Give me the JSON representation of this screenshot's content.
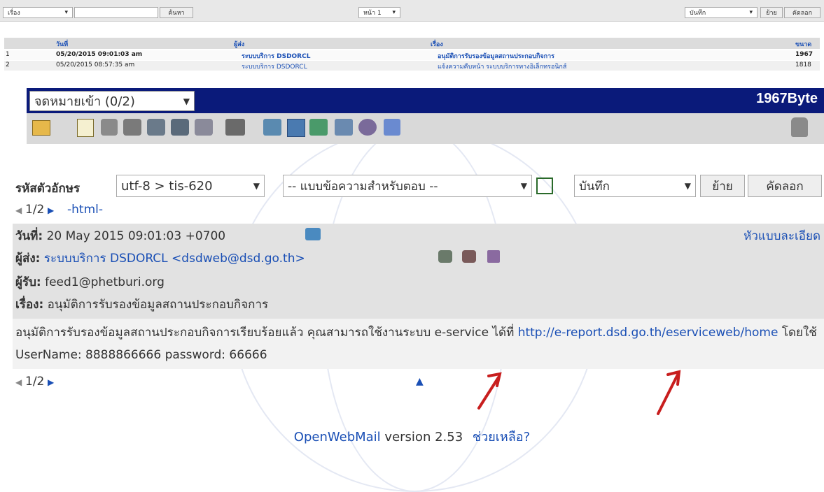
{
  "top_toolbar": {
    "folder_select": "เรื่อง",
    "search_button": "ค้นหา",
    "page_label": "หน้า 1",
    "save_select": "บันทึก",
    "move_button": "ย้าย",
    "copy_button": "คัดลอก"
  },
  "message_list": {
    "headers": {
      "date": "วันที่",
      "sender": "ผู้ส่ง",
      "subject": "เรื่อง",
      "size": "ขนาด"
    },
    "rows": [
      {
        "num": "1",
        "date": "05/20/2015 09:01:03 am",
        "sender": "ระบบบริการ DSDORCL",
        "subject": "อนุมัติการรับรองข้อมูลสถานประกอบกิจการ",
        "size": "1967"
      },
      {
        "num": "2",
        "date": "05/20/2015 08:57:35 am",
        "sender": "ระบบบริการ DSDORCL",
        "subject": "แจ้งความคืบหน้า ระบบบริการทางอิเล็กทรอนิกส์",
        "size": "1818"
      }
    ]
  },
  "read_header": {
    "folder_select": "จดหมายเข้า (0/2)",
    "size": "1967Byte"
  },
  "icons": [
    "folder-icon",
    "compose-icon",
    "reply-icon",
    "reply-all-icon",
    "forward-icon",
    "forward-attach-icon",
    "address-icon",
    "print-icon",
    "book-icon",
    "filter-icon",
    "calendar-icon",
    "notes-icon",
    "settings-icon",
    "logout-icon",
    "trash-icon"
  ],
  "encoding_bar": {
    "label": "รหัสตัวอักษร",
    "charset_select": "utf-8 > tis-620",
    "reply_template_select": "-- แบบข้อความสำหรับตอบ --",
    "save_select": "บันทึก",
    "move_button": "ย้าย",
    "copy_button": "คัดลอก"
  },
  "pager": {
    "position": "1/2",
    "html_link": "-html-"
  },
  "message": {
    "date_label": "วันที่:",
    "date_value": "20 May 2015 09:01:03 +0700",
    "detail_link": "หัวแบบละเอียด",
    "from_label": "ผู้ส่ง:",
    "from_value": "ระบบบริการ DSDORCL <dsdweb@dsd.go.th>",
    "to_label": "ผู้รับ:",
    "to_value": "feed1@phetburi.org",
    "subject_label": "เรื่อง:",
    "subject_value": "อนุมัติการรับรองข้อมูลสถานประกอบกิจการ",
    "body_part1": "อนุมัติการรับรองข้อมูลสถานประกอบกิจการเรียบร้อยแล้ว คุณสามารถใช้งานระบบ e-service ได้ที่",
    "body_link": "http://e-report.dsd.go.th/eserviceweb/home",
    "body_part2": "โดยใช้ UserName: 8888866666 password: 66666"
  },
  "footer": {
    "app": "OpenWebMail",
    "version": "version 2.53",
    "help": "ช่วยเหลือ?"
  },
  "colors": {
    "header_bar": "#0a1a7a",
    "accent_blue": "#1a4fb5",
    "annotation_red": "#c81e1e"
  }
}
